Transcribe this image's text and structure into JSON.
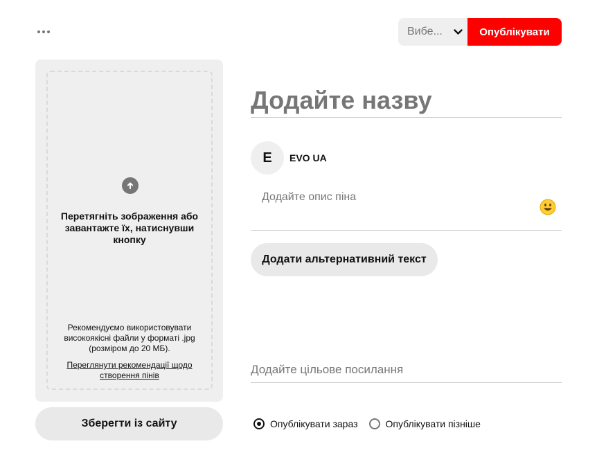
{
  "header": {
    "more_icon": "ellipsis-horizontal-icon",
    "board_select": {
      "value": "Вибе...",
      "icon": "chevron-down-icon"
    },
    "publish_label": "Опублікувати"
  },
  "upload": {
    "icon": "arrow-up-circle-icon",
    "title": "Перетягніть зображення або завантажте їх, натиснувши кнопку",
    "hint": "Рекомендуємо використовувати високоякісні файли у форматі .jpg (розміром до 20 МБ).",
    "link": "Переглянути рекомендації щодо створення пінів",
    "save_from_site_label": "Зберегти із сайту"
  },
  "form": {
    "title_placeholder": "Додайте назву",
    "user": {
      "avatar_letter": "E",
      "name": "EVO UA"
    },
    "description_placeholder": "Додайте опис піна",
    "emoji_icon": "smiley-face-icon",
    "alt_text_label": "Додати альтернативний текст",
    "link_placeholder": "Додайте цільове посилання",
    "publish_options": [
      {
        "label": "Опублікувати зараз",
        "checked": true
      },
      {
        "label": "Опублікувати пізніше",
        "checked": false
      }
    ]
  },
  "colors": {
    "accent_red": "#ff0000",
    "neutral_bg": "#efefef",
    "text_muted": "#767676"
  }
}
